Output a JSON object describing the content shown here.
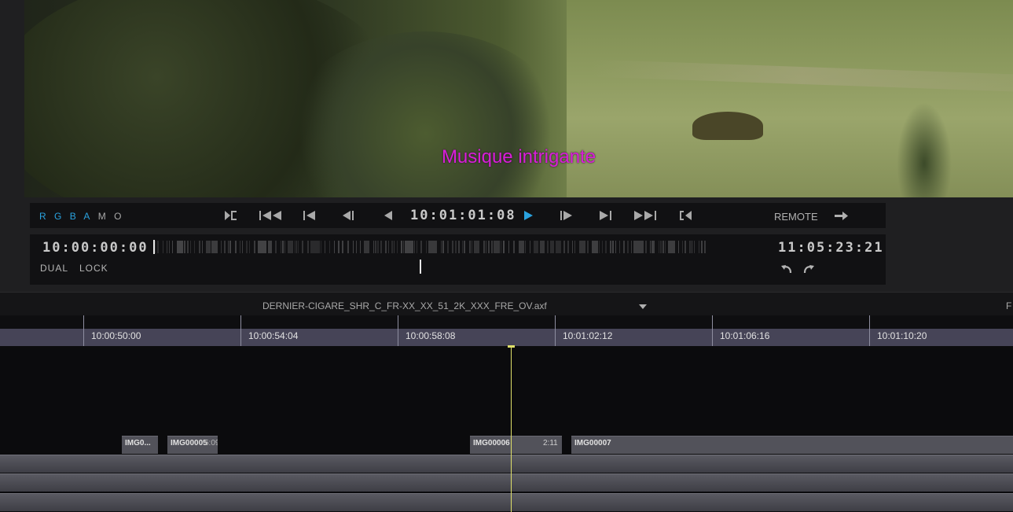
{
  "viewer": {
    "subtitle": "Musique intrigante"
  },
  "transport": {
    "channels": [
      {
        "label": "R",
        "color": "#2aa3e0"
      },
      {
        "label": "G",
        "color": "#2aa3e0"
      },
      {
        "label": "B",
        "color": "#2aa3e0"
      },
      {
        "label": "A",
        "color": "#2aa3e0"
      },
      {
        "label": "M",
        "color": "#a8a8a8"
      },
      {
        "label": "O",
        "color": "#a8a8a8"
      }
    ],
    "timecode": "10:01:01:08",
    "remote_label": "REMOTE",
    "play_color": "#2aa3e0"
  },
  "scrub": {
    "start_tc": "10:00:00:00",
    "end_tc": "11:05:23:21",
    "dual_label": "DUAL",
    "lock_label": "LOCK"
  },
  "timeline": {
    "filename": "DERNIER-CIGARE_SHR_C_FR-XX_XX_51_2K_XXX_FRE_OV.axf",
    "right_label": "F",
    "ruler_labels": [
      "10:00:50:00",
      "10:00:54:04",
      "10:00:58:08",
      "10:01:02:12",
      "10:01:06:16",
      "10:01:10:20"
    ],
    "clips": [
      {
        "name": "IMG0...",
        "extra": ""
      },
      {
        "name": "IMG00005",
        "extra": "5:09"
      },
      {
        "name": "IMG00006",
        "extra": "2:11"
      },
      {
        "name": "IMG00007",
        "extra": ""
      }
    ]
  }
}
